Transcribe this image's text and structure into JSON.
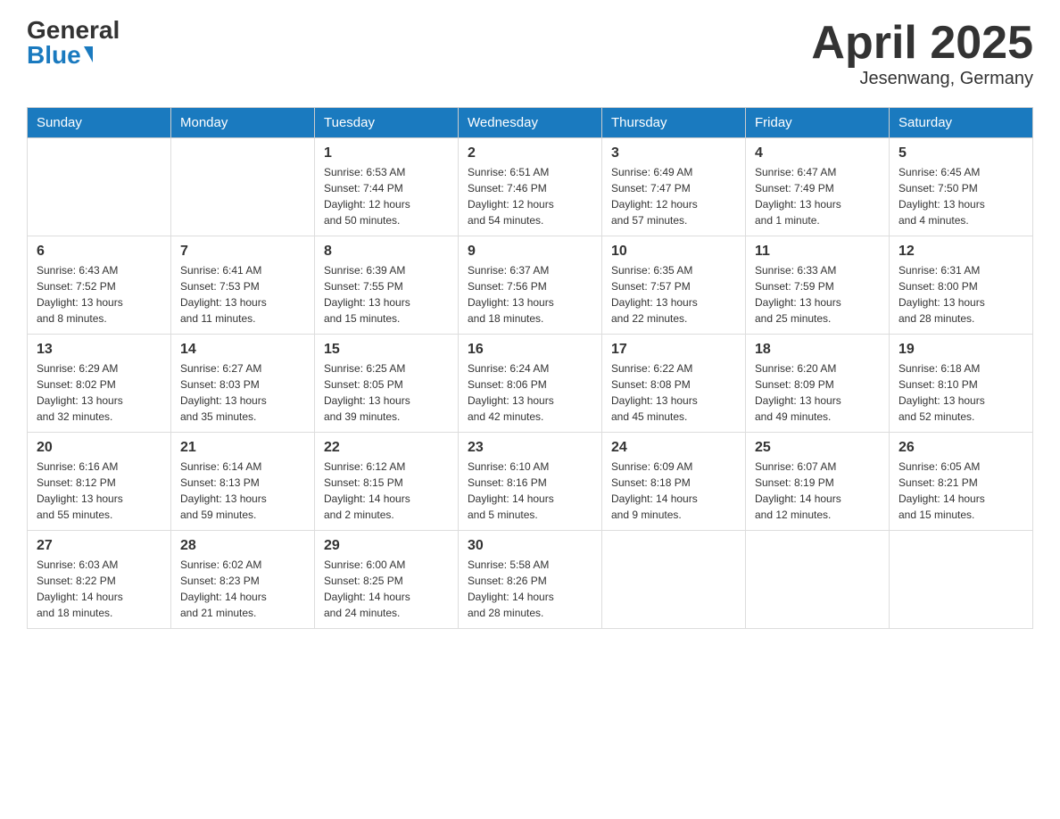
{
  "logo": {
    "general": "General",
    "blue": "Blue"
  },
  "header": {
    "title": "April 2025",
    "location": "Jesenwang, Germany"
  },
  "weekdays": [
    "Sunday",
    "Monday",
    "Tuesday",
    "Wednesday",
    "Thursday",
    "Friday",
    "Saturday"
  ],
  "weeks": [
    [
      {
        "day": "",
        "info": ""
      },
      {
        "day": "",
        "info": ""
      },
      {
        "day": "1",
        "info": "Sunrise: 6:53 AM\nSunset: 7:44 PM\nDaylight: 12 hours\nand 50 minutes."
      },
      {
        "day": "2",
        "info": "Sunrise: 6:51 AM\nSunset: 7:46 PM\nDaylight: 12 hours\nand 54 minutes."
      },
      {
        "day": "3",
        "info": "Sunrise: 6:49 AM\nSunset: 7:47 PM\nDaylight: 12 hours\nand 57 minutes."
      },
      {
        "day": "4",
        "info": "Sunrise: 6:47 AM\nSunset: 7:49 PM\nDaylight: 13 hours\nand 1 minute."
      },
      {
        "day": "5",
        "info": "Sunrise: 6:45 AM\nSunset: 7:50 PM\nDaylight: 13 hours\nand 4 minutes."
      }
    ],
    [
      {
        "day": "6",
        "info": "Sunrise: 6:43 AM\nSunset: 7:52 PM\nDaylight: 13 hours\nand 8 minutes."
      },
      {
        "day": "7",
        "info": "Sunrise: 6:41 AM\nSunset: 7:53 PM\nDaylight: 13 hours\nand 11 minutes."
      },
      {
        "day": "8",
        "info": "Sunrise: 6:39 AM\nSunset: 7:55 PM\nDaylight: 13 hours\nand 15 minutes."
      },
      {
        "day": "9",
        "info": "Sunrise: 6:37 AM\nSunset: 7:56 PM\nDaylight: 13 hours\nand 18 minutes."
      },
      {
        "day": "10",
        "info": "Sunrise: 6:35 AM\nSunset: 7:57 PM\nDaylight: 13 hours\nand 22 minutes."
      },
      {
        "day": "11",
        "info": "Sunrise: 6:33 AM\nSunset: 7:59 PM\nDaylight: 13 hours\nand 25 minutes."
      },
      {
        "day": "12",
        "info": "Sunrise: 6:31 AM\nSunset: 8:00 PM\nDaylight: 13 hours\nand 28 minutes."
      }
    ],
    [
      {
        "day": "13",
        "info": "Sunrise: 6:29 AM\nSunset: 8:02 PM\nDaylight: 13 hours\nand 32 minutes."
      },
      {
        "day": "14",
        "info": "Sunrise: 6:27 AM\nSunset: 8:03 PM\nDaylight: 13 hours\nand 35 minutes."
      },
      {
        "day": "15",
        "info": "Sunrise: 6:25 AM\nSunset: 8:05 PM\nDaylight: 13 hours\nand 39 minutes."
      },
      {
        "day": "16",
        "info": "Sunrise: 6:24 AM\nSunset: 8:06 PM\nDaylight: 13 hours\nand 42 minutes."
      },
      {
        "day": "17",
        "info": "Sunrise: 6:22 AM\nSunset: 8:08 PM\nDaylight: 13 hours\nand 45 minutes."
      },
      {
        "day": "18",
        "info": "Sunrise: 6:20 AM\nSunset: 8:09 PM\nDaylight: 13 hours\nand 49 minutes."
      },
      {
        "day": "19",
        "info": "Sunrise: 6:18 AM\nSunset: 8:10 PM\nDaylight: 13 hours\nand 52 minutes."
      }
    ],
    [
      {
        "day": "20",
        "info": "Sunrise: 6:16 AM\nSunset: 8:12 PM\nDaylight: 13 hours\nand 55 minutes."
      },
      {
        "day": "21",
        "info": "Sunrise: 6:14 AM\nSunset: 8:13 PM\nDaylight: 13 hours\nand 59 minutes."
      },
      {
        "day": "22",
        "info": "Sunrise: 6:12 AM\nSunset: 8:15 PM\nDaylight: 14 hours\nand 2 minutes."
      },
      {
        "day": "23",
        "info": "Sunrise: 6:10 AM\nSunset: 8:16 PM\nDaylight: 14 hours\nand 5 minutes."
      },
      {
        "day": "24",
        "info": "Sunrise: 6:09 AM\nSunset: 8:18 PM\nDaylight: 14 hours\nand 9 minutes."
      },
      {
        "day": "25",
        "info": "Sunrise: 6:07 AM\nSunset: 8:19 PM\nDaylight: 14 hours\nand 12 minutes."
      },
      {
        "day": "26",
        "info": "Sunrise: 6:05 AM\nSunset: 8:21 PM\nDaylight: 14 hours\nand 15 minutes."
      }
    ],
    [
      {
        "day": "27",
        "info": "Sunrise: 6:03 AM\nSunset: 8:22 PM\nDaylight: 14 hours\nand 18 minutes."
      },
      {
        "day": "28",
        "info": "Sunrise: 6:02 AM\nSunset: 8:23 PM\nDaylight: 14 hours\nand 21 minutes."
      },
      {
        "day": "29",
        "info": "Sunrise: 6:00 AM\nSunset: 8:25 PM\nDaylight: 14 hours\nand 24 minutes."
      },
      {
        "day": "30",
        "info": "Sunrise: 5:58 AM\nSunset: 8:26 PM\nDaylight: 14 hours\nand 28 minutes."
      },
      {
        "day": "",
        "info": ""
      },
      {
        "day": "",
        "info": ""
      },
      {
        "day": "",
        "info": ""
      }
    ]
  ]
}
